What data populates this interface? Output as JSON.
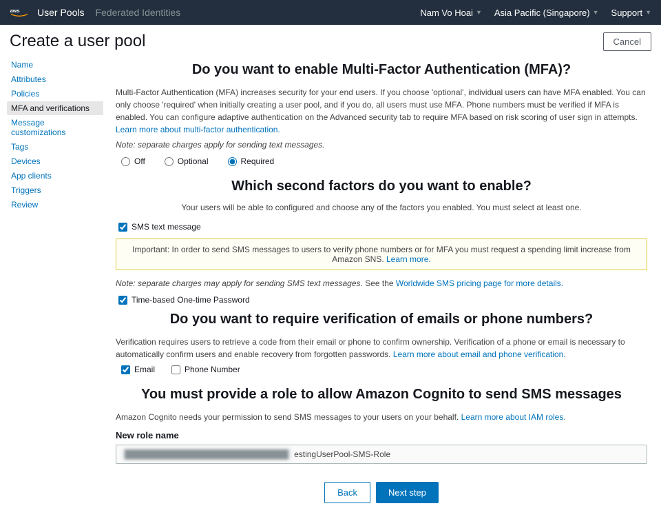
{
  "header": {
    "nav1": "User Pools",
    "nav2": "Federated Identities",
    "user": "Nam Vo Hoai",
    "region": "Asia Pacific (Singapore)",
    "support": "Support"
  },
  "page": {
    "title": "Create a user pool",
    "cancel": "Cancel"
  },
  "sidebar": {
    "items": [
      "Name",
      "Attributes",
      "Policies",
      "MFA and verifications",
      "Message customizations",
      "Tags",
      "Devices",
      "App clients",
      "Triggers",
      "Review"
    ],
    "activeIndex": 3
  },
  "mfa": {
    "title": "Do you want to enable Multi-Factor Authentication (MFA)?",
    "desc": "Multi-Factor Authentication (MFA) increases security for your end users. If you choose 'optional', individual users can have MFA enabled. You can only choose 'required' when initially creating a user pool, and if you do, all users must use MFA. Phone numbers must be verified if MFA is enabled. You can configure adaptive authentication on the Advanced security tab to require MFA based on risk scoring of user sign in attempts. ",
    "learn": "Learn more about multi-factor authentication.",
    "note": "Note: separate charges apply for sending text messages.",
    "off": "Off",
    "optional": "Optional",
    "required": "Required"
  },
  "factors": {
    "title": "Which second factors do you want to enable?",
    "sub": "Your users will be able to configured and choose any of the factors you enabled. You must select at least one.",
    "sms": "SMS text message",
    "warnPrefix": "Important: In order to send SMS messages to users to verify phone numbers or for MFA you must request a spending limit increase from Amazon SNS. ",
    "warnLink": "Learn more.",
    "noteA": "Note: separate charges may apply for sending SMS text messages. ",
    "noteB": "See the ",
    "noteLink": "Worldwide SMS pricing page for more details.",
    "totp": "Time-based One-time Password"
  },
  "verify": {
    "title": "Do you want to require verification of emails or phone numbers?",
    "desc": "Verification requires users to retrieve a code from their email or phone to confirm ownership. Verification of a phone or email is necessary to automatically confirm users and enable recovery from forgotten passwords. ",
    "learn": "Learn more about email and phone verification.",
    "email": "Email",
    "phone": "Phone Number"
  },
  "role": {
    "title": "You must provide a role to allow Amazon Cognito to send SMS messages",
    "desc": "Amazon Cognito needs your permission to send SMS messages to your users on your behalf. ",
    "learn": "Learn more about IAM roles.",
    "label": "New role name",
    "value": "estingUserPool-SMS-Role"
  },
  "buttons": {
    "back": "Back",
    "next": "Next step"
  }
}
